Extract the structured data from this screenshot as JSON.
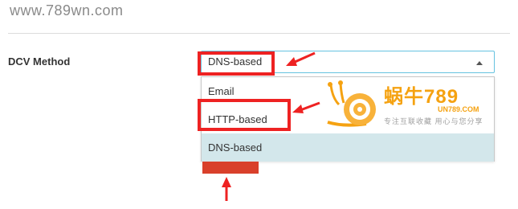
{
  "site": {
    "url": "www.789wn.com"
  },
  "form": {
    "label": "DCV Method",
    "select": {
      "value": "DNS-based",
      "options": [
        "Email",
        "HTTP-based",
        "DNS-based"
      ],
      "highlighted_option": "DNS-based"
    }
  },
  "watermark": {
    "brand": "蜗牛789",
    "domain": "UN789.COM",
    "slogan": "专注互联收藏   用心与您分享"
  },
  "colors": {
    "annotation_red": "#ee2222",
    "select_focus_border": "#66c2e0",
    "highlight_row": "#d3e7eb",
    "button_red": "#d9402b",
    "watermark_orange": "#f5a211"
  }
}
